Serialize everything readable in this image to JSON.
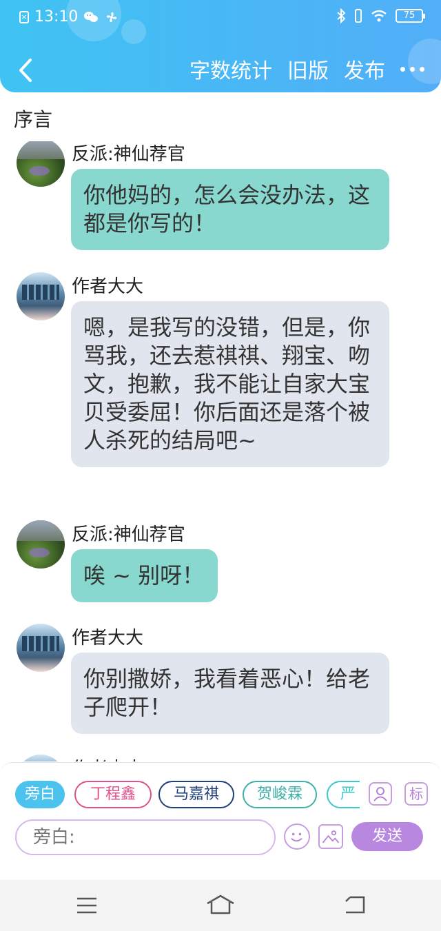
{
  "status_bar": {
    "time": "13:10",
    "battery": "75",
    "icons": [
      "sim-icon",
      "wechat-icon",
      "fan-icon",
      "bluetooth-icon",
      "vibrate-icon",
      "wifi-icon",
      "battery-icon"
    ]
  },
  "nav": {
    "back_icon": "chevron-left-icon",
    "word_count": "字数统计",
    "old_version": "旧版",
    "publish": "发布",
    "more_icon": "more-dots-icon"
  },
  "section_title": "序言",
  "messages": [
    {
      "sender": "反派:神仙荐官",
      "avatar": "nature-avatar",
      "style": "teal",
      "text": "你他妈的，怎么会没办法，这都是你写的！"
    },
    {
      "sender": "作者大大",
      "avatar": "group-avatar",
      "style": "gray",
      "text": "嗯，是我写的没错，但是，你骂我，还去惹祺祺、翔宝、吻文，抱歉，我不能让自家大宝贝受委屈！你后面还是落个被人杀死的结局吧~"
    },
    {
      "sender": "反派:神仙荐官",
      "avatar": "nature-avatar",
      "style": "teal",
      "text": "唉 ~ 别呀！"
    },
    {
      "sender": "作者大大",
      "avatar": "group-avatar",
      "style": "gray",
      "text": "你别撒娇，我看着恶心！给老子爬开！"
    },
    {
      "sender": "作者大大",
      "avatar": "group-avatar",
      "style": "gray",
      "text": ""
    }
  ],
  "characters": [
    {
      "label": "旁白",
      "color": "#4cc3ef",
      "active": true
    },
    {
      "label": "丁程鑫",
      "color": "#e0508a",
      "active": false
    },
    {
      "label": "马嘉祺",
      "color": "#1e3f7a",
      "active": false
    },
    {
      "label": "贺峻霖",
      "color": "#3fb0a8",
      "active": false
    },
    {
      "label": "严",
      "color": "#3ec8c8",
      "active": false
    }
  ],
  "tools": {
    "character_icon": "person-card-icon",
    "tag_label": "标"
  },
  "input": {
    "placeholder": "旁白:"
  },
  "send_label": "发送",
  "system_nav": [
    "menu-icon",
    "home-icon",
    "back-icon"
  ]
}
